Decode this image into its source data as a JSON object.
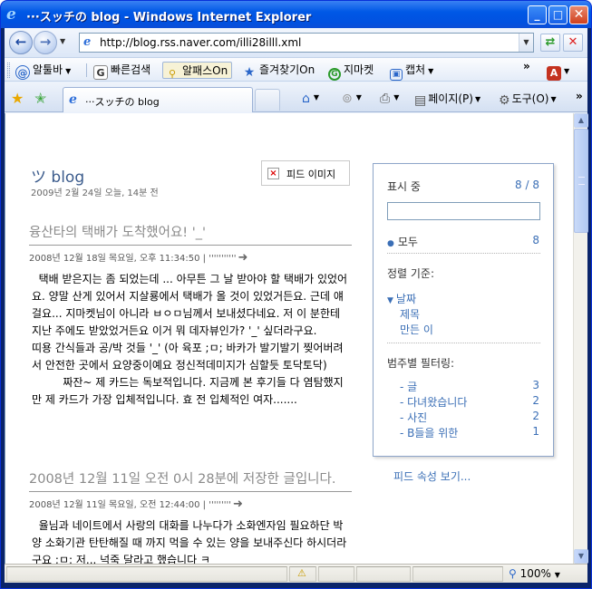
{
  "window": {
    "title": "···スッチの blog - Windows Internet Explorer",
    "min": "_",
    "max": "□",
    "close": "✕"
  },
  "address": {
    "url": "http://blog.rss.naver.com/illi28illl.xml"
  },
  "links_toolbar": {
    "items": [
      "알툴바",
      "빠른검색",
      "알패스On",
      "즐겨찾기On",
      "지마켓",
      "캡처"
    ],
    "chevron": "»"
  },
  "tabs": {
    "active_label": "···スッチの blog",
    "commands": [
      "페이지(P)",
      "도구(O)"
    ],
    "chevron": "»"
  },
  "feed": {
    "title": "ツ blog",
    "date": "2009년 2월 24일 오늘, 14분 전",
    "image_label": "피드 이미지",
    "entries": [
      {
        "title": "융산타의 택배가 도착했어요! '_'",
        "meta": "2008년 12월 18일 목요일, 오후 11:34:50 | '''''''''''",
        "body": "  택배 받은지는 좀 되었는데 ... 아무튼 그 날 받아야 할 택배가 있었어요. 양말 산게 있어서 지살룡에서 택배가 올 것이 있었거든요. 근데 얘걸요... 지마켓님이 아니라 ㅂㅇㅁ님께서 보내셨다네요. 저 이 분한테 지난 주에도 받았었거든요 이거 뭐 데자뷰인가? '_' 싶더라구요.           띠용 간식들과 공/박 것들 '_' (아 육포 ;ㅁ; 바카가 발기발기 찢어버려서 안전한 곳에서 요양중이예요 정신적데미지가 심할듯 토닥토닥)\n         짜잔~ 제 카드는 독보적입니다. 지금께 본 후기들 다 염탐했지만 제 카드가 가장 입체적입니다. 효 전 입체적인 여자......."
      },
      {
        "title": "2008년 12월 11일 오전 0시 28분에 저장한 글입니다.",
        "meta": "2008년 12월 11일 목요일, 오전 12:44:00 | '''''''''",
        "body": "  율님과 네이트에서 사랑의 대화를 나누다가 소화엔자임 필요하단 박양 소화기관 탄탄해질 때 까지 먹을 수 있는 양을 보내주신다 하시더라구요 ;ㅁ; 저... 넉죽 달라고 했습니다 ㅋ"
      }
    ]
  },
  "panel": {
    "showing_label": "표시 중",
    "showing_count": "8 / 8",
    "all_label": "모두",
    "all_count": "8",
    "sort_label": "정렬 기준:",
    "sort_options": [
      "날짜",
      "제목",
      "만든 이"
    ],
    "category_label": "범주별 필터링:",
    "categories": [
      {
        "name": "- 글",
        "count": "3"
      },
      {
        "name": "- 다녀왔습니다",
        "count": "2"
      },
      {
        "name": "- 사진",
        "count": "2"
      },
      {
        "name": "- B들을 위한",
        "count": "1"
      }
    ],
    "feed_props": "피드 속성 보기..."
  },
  "status": {
    "zoom": "100%"
  },
  "colors": {
    "link": "#3b6fb6",
    "title_bar": "#0058e6"
  }
}
